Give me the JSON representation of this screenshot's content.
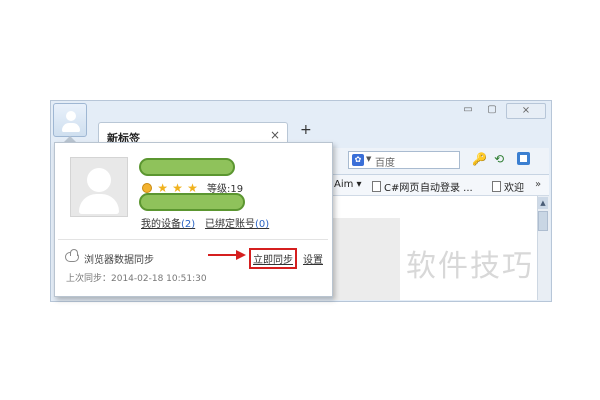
{
  "window": {
    "tab_title": "新标签",
    "tab_close": "×",
    "new_tab": "+",
    "controls": {
      "minimize": "▭",
      "maximize": "▢",
      "close": "⨯"
    }
  },
  "toolbar": {
    "search_placeholder": "百度",
    "search_engine_icon": "paw-icon",
    "icons": [
      "key-icon",
      "refresh-icon",
      "app-grid-icon"
    ]
  },
  "bookmarks": {
    "items": [
      {
        "label": "Aim ▾"
      },
      {
        "label": "C#网页"
      },
      {
        "label": "自动登录 ..."
      },
      {
        "label": "欢迎"
      }
    ],
    "more": "»"
  },
  "popup": {
    "level_text": "等级:19",
    "stars": [
      "★",
      "★",
      "★"
    ],
    "links": {
      "my_devices_label": "我的设备",
      "my_devices_count": "(2)",
      "bound_accounts_label": "已绑定账号",
      "bound_accounts_count": "(0)"
    },
    "sync": {
      "label": "浏览器数据同步",
      "sync_now": "立即同步",
      "settings": "设置",
      "last_sync": "上次同步：2014-02-18 10:51:30"
    }
  },
  "watermark": "软件技巧",
  "colors": {
    "highlight_box": "#d51f1f",
    "arrow": "#d51f1f",
    "pill_fill": "#8fc25b",
    "star": "#f0b21e"
  }
}
